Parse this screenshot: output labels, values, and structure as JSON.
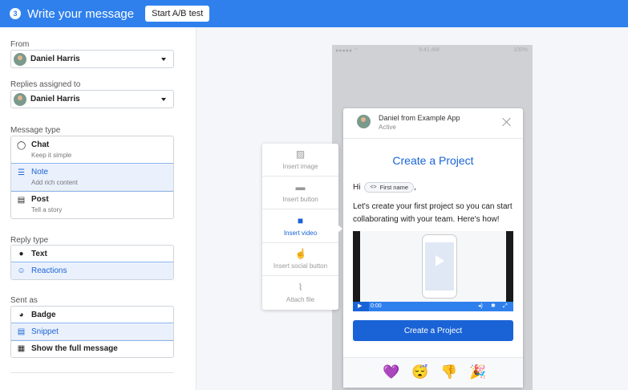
{
  "header": {
    "step": "3",
    "title": "Write your message",
    "ab_button": "Start A/B test"
  },
  "from": {
    "label": "From",
    "value": "Daniel Harris"
  },
  "assigned": {
    "label": "Replies assigned to",
    "value": "Daniel Harris"
  },
  "message_type": {
    "label": "Message type",
    "options": [
      {
        "title": "Chat",
        "subtitle": "Keep it simple",
        "icon": "chat-bubble-icon",
        "selected": false
      },
      {
        "title": "Note",
        "subtitle": "Add rich content",
        "icon": "note-icon",
        "selected": true
      },
      {
        "title": "Post",
        "subtitle": "Tell a story",
        "icon": "post-icon",
        "selected": false
      }
    ]
  },
  "reply_type": {
    "label": "Reply type",
    "options": [
      {
        "title": "Text",
        "icon": "text-bubble-icon",
        "selected": false
      },
      {
        "title": "Reactions",
        "icon": "smile-icon",
        "selected": true
      }
    ]
  },
  "sent_as": {
    "label": "Sent as",
    "options": [
      {
        "title": "Badge",
        "icon": "badge-icon",
        "selected": false
      },
      {
        "title": "Snippet",
        "icon": "snippet-icon",
        "selected": true
      },
      {
        "title": "Show the full message",
        "icon": "full-message-icon",
        "selected": false
      }
    ]
  },
  "phone_status": {
    "carrier": "●●●●● ⌔",
    "time": "9:41 AM",
    "battery": "100%"
  },
  "insert_menu": [
    {
      "label": "Insert image",
      "icon": "image-icon",
      "active": false
    },
    {
      "label": "Insert button",
      "icon": "button-icon",
      "active": false
    },
    {
      "label": "Insert video",
      "icon": "video-icon",
      "active": true
    },
    {
      "label": "Insert social button",
      "icon": "thumbs-up-icon",
      "active": false
    },
    {
      "label": "Attach file",
      "icon": "paperclip-icon",
      "active": false
    }
  ],
  "card": {
    "sender": "Daniel from Example App",
    "status": "Active",
    "title": "Create a Project",
    "greeting": "Hi",
    "pill_code": "<>",
    "pill_label": "First name",
    "greeting_suffix": ",",
    "body": "Let's create your first project so you can start collaborating with your team. Here's how!",
    "video_time": "0:00",
    "video_progress": 0.1,
    "cta": "Create a Project",
    "reactions": [
      "💜",
      "😴",
      "👎",
      "🎉"
    ]
  },
  "colors": {
    "brand": "#2f80ed",
    "accent": "#1a63d6"
  }
}
